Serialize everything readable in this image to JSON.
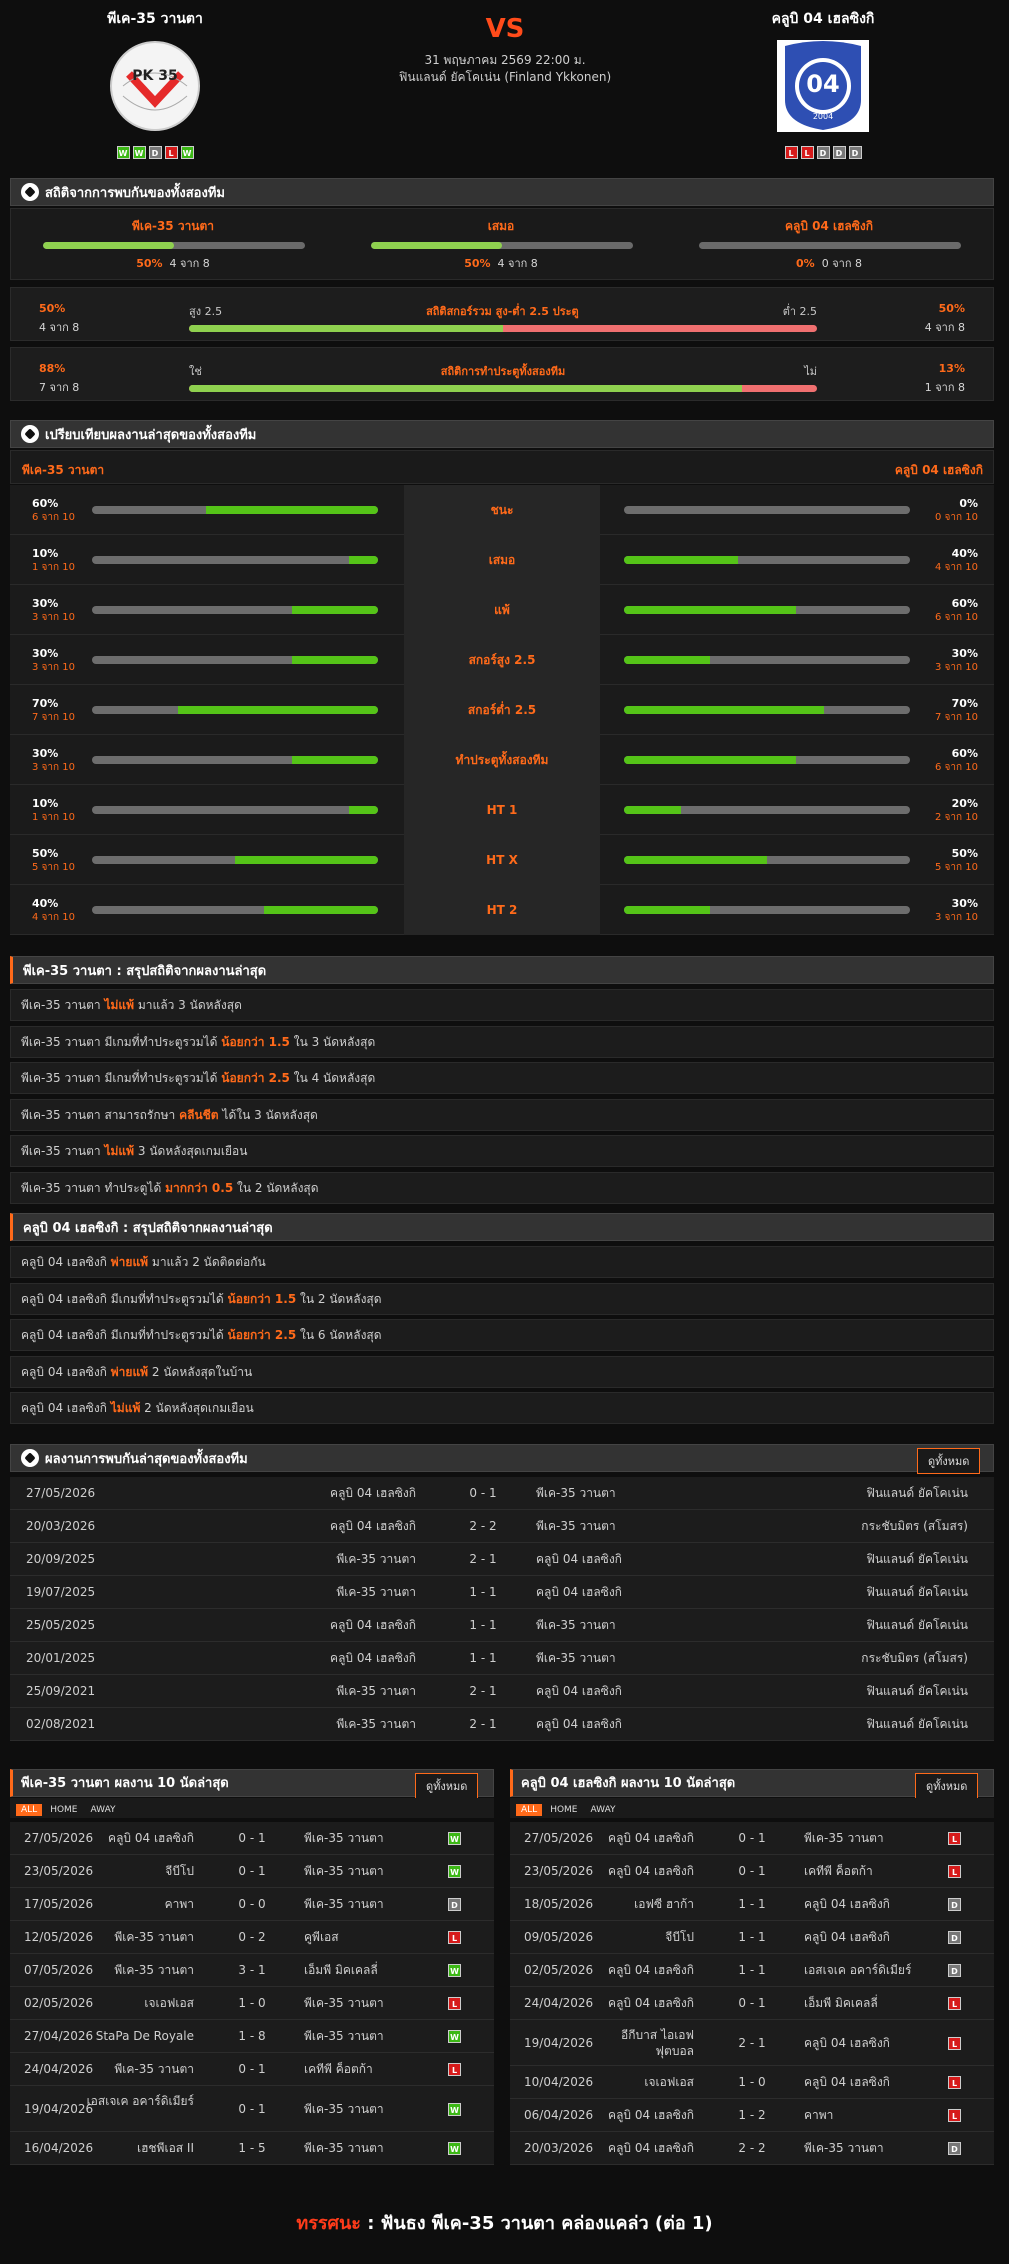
{
  "header": {
    "home": {
      "name": "พีเค-35 วานตา",
      "form": [
        "W",
        "W",
        "D",
        "L",
        "W"
      ]
    },
    "away": {
      "name": "คลูบิ 04 เฮลซิงกิ",
      "form": [
        "L",
        "L",
        "D",
        "D",
        "D"
      ]
    },
    "vs": "VS",
    "datetime": "31 พฤษภาคม 2569 22:00 ม.",
    "league": "ฟินแลนด์ ยัคโคเน่น (Finland Ykkonen)",
    "home_logo_text": "PK 35",
    "away_logo_text": "04",
    "away_logo_year": "2004"
  },
  "h2h_stats": {
    "title": "สถิติจากการพบกันของทั้งสองทีม",
    "cols": [
      {
        "label": "พีเค-35 วานตา",
        "pct": "50%",
        "count": "4 จาก 8",
        "fill": 0.5
      },
      {
        "label": "เสมอ",
        "pct": "50%",
        "count": "4 จาก 8",
        "fill": 0.5
      },
      {
        "label": "คลูบิ 04 เฮลซิงกิ",
        "pct": "0%",
        "count": "0 จาก 8",
        "fill": 0
      }
    ],
    "ou": {
      "l_pct": "50%",
      "l_count": "4 จาก 8",
      "l_label": "สูง 2.5",
      "center": "สถิติสกอร์รวม สูง-ต่ำ 2.5 ประตู",
      "r_label": "ต่ำ 2.5",
      "r_pct": "50%",
      "r_count": "4 จาก 8",
      "fill": 0.5
    },
    "btts": {
      "l_pct": "88%",
      "l_count": "7 จาก 8",
      "l_label": "ใช่",
      "center": "สถิติการทำประตูทั้งสองทีม",
      "r_label": "ไม่",
      "r_pct": "13%",
      "r_count": "1 จาก 8",
      "fill": 0.88
    }
  },
  "compare": {
    "title": "เปรียบเทียบผลงานล่าสุดของทั้งสองทีม",
    "home": "พีเค-35 วานตา",
    "away": "คลูบิ 04 เฮลซิงกิ",
    "rows": [
      {
        "label": "ชนะ",
        "hp": "60%",
        "hc": "6 จาก 10",
        "hv": 0.6,
        "ap": "0%",
        "ac": "0 จาก 10",
        "av": 0
      },
      {
        "label": "เสมอ",
        "hp": "10%",
        "hc": "1 จาก 10",
        "hv": 0.1,
        "ap": "40%",
        "ac": "4 จาก 10",
        "av": 0.4
      },
      {
        "label": "แพ้",
        "hp": "30%",
        "hc": "3 จาก 10",
        "hv": 0.3,
        "ap": "60%",
        "ac": "6 จาก 10",
        "av": 0.6
      },
      {
        "label": "สกอร์สูง 2.5",
        "hp": "30%",
        "hc": "3 จาก 10",
        "hv": 0.3,
        "ap": "30%",
        "ac": "3 จาก 10",
        "av": 0.3
      },
      {
        "label": "สกอร์ต่ำ 2.5",
        "hp": "70%",
        "hc": "7 จาก 10",
        "hv": 0.7,
        "ap": "70%",
        "ac": "7 จาก 10",
        "av": 0.7
      },
      {
        "label": "ทำประตูทั้งสองทีม",
        "hp": "30%",
        "hc": "3 จาก 10",
        "hv": 0.3,
        "ap": "60%",
        "ac": "6 จาก 10",
        "av": 0.6
      },
      {
        "label": "HT 1",
        "hp": "10%",
        "hc": "1 จาก 10",
        "hv": 0.1,
        "ap": "20%",
        "ac": "2 จาก 10",
        "av": 0.2
      },
      {
        "label": "HT X",
        "hp": "50%",
        "hc": "5 จาก 10",
        "hv": 0.5,
        "ap": "50%",
        "ac": "5 จาก 10",
        "av": 0.5
      },
      {
        "label": "HT 2",
        "hp": "40%",
        "hc": "4 จาก 10",
        "hv": 0.4,
        "ap": "30%",
        "ac": "3 จาก 10",
        "av": 0.3
      }
    ]
  },
  "home_summary": {
    "title": "พีเค-35 วานตา : สรุปสถิติจากผลงานล่าสุด",
    "rows": [
      {
        "a": "พีเค-35 วานตา ",
        "h": "ไม่แพ้",
        "b": " มาแล้ว 3 นัดหลังสุด"
      },
      {
        "a": "พีเค-35 วานตา มีเกมที่ทำประตูรวมได้ ",
        "h": "น้อยกว่า 1.5",
        "b": " ใน 3 นัดหลังสุด"
      },
      {
        "a": "พีเค-35 วานตา มีเกมที่ทำประตูรวมได้ ",
        "h": "น้อยกว่า 2.5",
        "b": " ใน 4 นัดหลังสุด"
      },
      {
        "a": "พีเค-35 วานตา สามารถรักษา ",
        "h": "คลีนชีต",
        "b": " ได้ใน 3 นัดหลังสุด"
      },
      {
        "a": "พีเค-35 วานตา ",
        "h": "ไม่แพ้",
        "b": " 3 นัดหลังสุดเกมเยือน"
      },
      {
        "a": "พีเค-35 วานตา ทำประตูได้ ",
        "h": "มากกว่า 0.5",
        "b": " ใน 2 นัดหลังสุด"
      }
    ]
  },
  "away_summary": {
    "title": "คลูบิ 04 เฮลซิงกิ : สรุปสถิติจากผลงานล่าสุด",
    "rows": [
      {
        "a": "คลูบิ 04 เฮลซิงกิ ",
        "h": "พ่ายแพ้",
        "b": " มาแล้ว 2 นัดติดต่อกัน"
      },
      {
        "a": "คลูบิ 04 เฮลซิงกิ มีเกมที่ทำประตูรวมได้ ",
        "h": "น้อยกว่า 1.5",
        "b": " ใน 2 นัดหลังสุด"
      },
      {
        "a": "คลูบิ 04 เฮลซิงกิ มีเกมที่ทำประตูรวมได้ ",
        "h": "น้อยกว่า 2.5",
        "b": " ใน 6 นัดหลังสุด"
      },
      {
        "a": "คลูบิ 04 เฮลซิงกิ ",
        "h": "พ่ายแพ้",
        "b": " 2 นัดหลังสุดในบ้าน"
      },
      {
        "a": "คลูบิ 04 เฮลซิงกิ ",
        "h": "ไม่แพ้",
        "b": " 2 นัดหลังสุดเกมเยือน"
      }
    ]
  },
  "h2h_results": {
    "title": "ผลงานการพบกันล่าสุดของทั้งสองทีม",
    "view_all": "ดูทั้งหมด",
    "rows": [
      {
        "date": "27/05/2026",
        "home": "คลูบิ 04 เฮลซิงกิ",
        "score": "0 - 1",
        "away": "พีเค-35 วานตา",
        "comp": "ฟินแลนด์ ยัคโคเน่น"
      },
      {
        "date": "20/03/2026",
        "home": "คลูบิ 04 เฮลซิงกิ",
        "score": "2 - 2",
        "away": "พีเค-35 วานตา",
        "comp": "กระชับมิตร (สโมสร)"
      },
      {
        "date": "20/09/2025",
        "home": "พีเค-35 วานตา",
        "score": "2 - 1",
        "away": "คลูบิ 04 เฮลซิงกิ",
        "comp": "ฟินแลนด์ ยัคโคเน่น"
      },
      {
        "date": "19/07/2025",
        "home": "พีเค-35 วานตา",
        "score": "1 - 1",
        "away": "คลูบิ 04 เฮลซิงกิ",
        "comp": "ฟินแลนด์ ยัคโคเน่น"
      },
      {
        "date": "25/05/2025",
        "home": "คลูบิ 04 เฮลซิงกิ",
        "score": "1 - 1",
        "away": "พีเค-35 วานตา",
        "comp": "ฟินแลนด์ ยัคโคเน่น"
      },
      {
        "date": "20/01/2025",
        "home": "คลูบิ 04 เฮลซิงกิ",
        "score": "1 - 1",
        "away": "พีเค-35 วานตา",
        "comp": "กระชับมิตร (สโมสร)"
      },
      {
        "date": "25/09/2021",
        "home": "พีเค-35 วานตา",
        "score": "2 - 1",
        "away": "คลูบิ 04 เฮลซิงกิ",
        "comp": "ฟินแลนด์ ยัคโคเน่น"
      },
      {
        "date": "02/08/2021",
        "home": "พีเค-35 วานตา",
        "score": "2 - 1",
        "away": "คลูบิ 04 เฮลซิงกิ",
        "comp": "ฟินแลนด์ ยัคโคเน่น"
      }
    ]
  },
  "last10_home": {
    "title": "พีเค-35 วานตา ผลงาน 10 นัดล่าสุด",
    "view_all": "ดูทั้งหมด",
    "tabs": [
      "ALL",
      "HOME",
      "AWAY"
    ],
    "rows": [
      {
        "date": "27/05/2026",
        "home": "คลูบิ 04 เฮลซิงกิ",
        "score": "0 - 1",
        "away": "พีเค-35 วานตา",
        "res": "W"
      },
      {
        "date": "23/05/2026",
        "home": "จีบีโป",
        "score": "0 - 1",
        "away": "พีเค-35 วานตา",
        "res": "W"
      },
      {
        "date": "17/05/2026",
        "home": "คาพา",
        "score": "0 - 0",
        "away": "พีเค-35 วานตา",
        "res": "D"
      },
      {
        "date": "12/05/2026",
        "home": "พีเค-35 วานตา",
        "score": "0 - 2",
        "away": "คูพีเอส",
        "res": "L"
      },
      {
        "date": "07/05/2026",
        "home": "พีเค-35 วานตา",
        "score": "3 - 1",
        "away": "เอ็มพี มิคเคลลี่",
        "res": "W"
      },
      {
        "date": "02/05/2026",
        "home": "เจเอฟเอส",
        "score": "1 - 0",
        "away": "พีเค-35 วานตา",
        "res": "L"
      },
      {
        "date": "27/04/2026",
        "home": "StaPa De Royale",
        "score": "1 - 8",
        "away": "พีเค-35 วานตา",
        "res": "W"
      },
      {
        "date": "24/04/2026",
        "home": "พีเค-35 วานตา",
        "score": "0 - 1",
        "away": "เคทีพี ค็อตก้า",
        "res": "L"
      },
      {
        "date": "19/04/2026",
        "home": "เอสเจเค อคาร์ดิเมียร์",
        "score": "0 - 1",
        "away": "พีเค-35 วานตา",
        "res": "W"
      },
      {
        "date": "16/04/2026",
        "home": "เฮชพีเอส II",
        "score": "1 - 5",
        "away": "พีเค-35 วานตา",
        "res": "W"
      }
    ]
  },
  "last10_away": {
    "title": "คลูบิ 04 เฮลซิงกิ ผลงาน 10 นัดล่าสุด",
    "view_all": "ดูทั้งหมด",
    "tabs": [
      "ALL",
      "HOME",
      "AWAY"
    ],
    "rows": [
      {
        "date": "27/05/2026",
        "home": "คลูบิ 04 เฮลซิงกิ",
        "score": "0 - 1",
        "away": "พีเค-35 วานตา",
        "res": "L"
      },
      {
        "date": "23/05/2026",
        "home": "คลูบิ 04 เฮลซิงกิ",
        "score": "0 - 1",
        "away": "เคทีพี ค็อตก้า",
        "res": "L"
      },
      {
        "date": "18/05/2026",
        "home": "เอฟซี ฮาก้า",
        "score": "1 - 1",
        "away": "คลูบิ 04 เฮลซิงกิ",
        "res": "D"
      },
      {
        "date": "09/05/2026",
        "home": "จีบีโป",
        "score": "1 - 1",
        "away": "คลูบิ 04 เฮลซิงกิ",
        "res": "D"
      },
      {
        "date": "02/05/2026",
        "home": "คลูบิ 04 เฮลซิงกิ",
        "score": "1 - 1",
        "away": "เอสเจเค อคาร์ดิเมียร์",
        "res": "D"
      },
      {
        "date": "24/04/2026",
        "home": "คลูบิ 04 เฮลซิงกิ",
        "score": "0 - 1",
        "away": "เอ็มพี มิคเคลลี่",
        "res": "L"
      },
      {
        "date": "19/04/2026",
        "home": "อีกีบาส ไอเอฟ ฟุตบอล",
        "score": "2 - 1",
        "away": "คลูบิ 04 เฮลซิงกิ",
        "res": "L"
      },
      {
        "date": "10/04/2026",
        "home": "เจเอฟเอส",
        "score": "1 - 0",
        "away": "คลูบิ 04 เฮลซิงกิ",
        "res": "L"
      },
      {
        "date": "06/04/2026",
        "home": "คลูบิ 04 เฮลซิงกิ",
        "score": "1 - 2",
        "away": "คาพา",
        "res": "L"
      },
      {
        "date": "20/03/2026",
        "home": "คลูบิ 04 เฮลซิงกิ",
        "score": "2 - 2",
        "away": "พีเค-35 วานตา",
        "res": "D"
      }
    ]
  },
  "verdict": {
    "key": "ทรรศนะ",
    "sep": " : ",
    "text": "ฟันธง พีเค-35 วานตา คล่องแคล่ว (ต่อ 1)"
  },
  "colors": {
    "accent": "#ff6a1a",
    "win": "#3cb815",
    "loss": "#d61a1a",
    "draw": "#777777",
    "bar_green": "#55c418"
  }
}
